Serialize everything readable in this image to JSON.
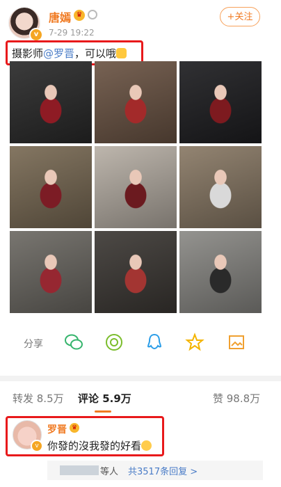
{
  "post": {
    "user_name": "唐嫣",
    "time": "7-29 19:22",
    "follow_label": "+关注",
    "text_prefix": "摄影师",
    "mention": "@罗晋",
    "text_suffix": "，可以哦",
    "photos": [
      {
        "alt": "photo-1",
        "bg": "#2b2b2b",
        "accent": "#8e1b24"
      },
      {
        "alt": "photo-2",
        "bg": "#6c5545",
        "accent": "#a32a2a"
      },
      {
        "alt": "photo-3",
        "bg": "#1f1f22",
        "accent": "#7d1a1f"
      },
      {
        "alt": "photo-4",
        "bg": "#7a6b55",
        "accent": "#7c1c25"
      },
      {
        "alt": "photo-5",
        "bg": "#b8b0a6",
        "accent": "#6b1a1f"
      },
      {
        "alt": "photo-6",
        "bg": "#8a7a66",
        "accent": "#d9d9d9"
      },
      {
        "alt": "photo-7",
        "bg": "#6d6a64",
        "accent": "#962731"
      },
      {
        "alt": "photo-8",
        "bg": "#3e3a36",
        "accent": "#a33532"
      },
      {
        "alt": "photo-9",
        "bg": "#8b8a86",
        "accent": "#2a2a2a"
      }
    ]
  },
  "actions": {
    "share_label": "分享",
    "icons": [
      "wechat-icon",
      "moments-icon",
      "qq-icon",
      "star-icon",
      "image-save-icon"
    ]
  },
  "tabs": {
    "repost": "转发 8.5万",
    "comments": "评论 5.9万",
    "likes": "赞 98.8万"
  },
  "comment": {
    "user_name": "罗晋",
    "text": "你發的沒我發的好看",
    "reply_user": "等人",
    "reply_more": "共3517条回复 >"
  },
  "colors": {
    "brand": "#f07a22",
    "highlight": "#e8191b",
    "link": "#4a7cc7"
  }
}
